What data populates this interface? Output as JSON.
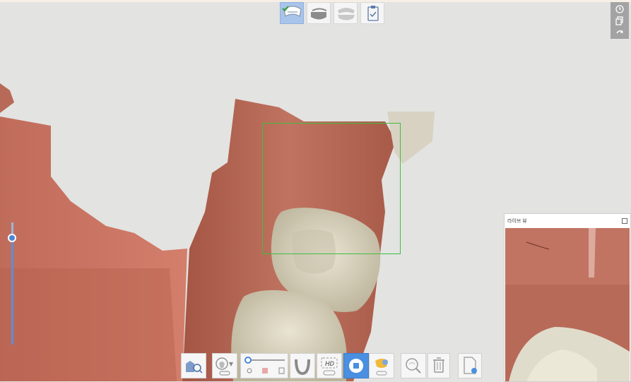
{
  "top_tabs": [
    {
      "label": "upper-jaw",
      "icon": "upper-jaw-icon",
      "active": true,
      "done": true
    },
    {
      "label": "lower-jaw",
      "icon": "lower-jaw-icon",
      "active": false,
      "done": false
    },
    {
      "label": "bite",
      "icon": "bite-icon",
      "active": false,
      "done": false
    },
    {
      "label": "review",
      "icon": "checklist-icon",
      "active": false,
      "done": false
    }
  ],
  "right_tools": [
    "history-icon",
    "copy-icon",
    "undo-icon"
  ],
  "live_view": {
    "title": "라이브 뷰"
  },
  "bottom_tools": [
    {
      "name": "scan-mode-button",
      "icon": "scan-person-icon"
    },
    {
      "name": "filter-settings-button",
      "icon": "tooth-filter-icon"
    },
    {
      "name": "brush-size-slider",
      "icon": "slider-icon"
    },
    {
      "name": "arch-view-button",
      "icon": "arch-icon"
    },
    {
      "name": "hd-mode-button",
      "icon": "hd-icon"
    },
    {
      "name": "stop-scan-button",
      "icon": "stop-icon"
    },
    {
      "name": "ai-scan-button",
      "icon": "ai-tooth-icon"
    },
    {
      "name": "zoom-3d-button",
      "icon": "zoom-3d-icon"
    },
    {
      "name": "delete-button",
      "icon": "trash-icon"
    },
    {
      "name": "export-button",
      "icon": "file-export-icon"
    }
  ],
  "colors": {
    "gum": "#b86a58",
    "tooth": "#d9d4c2",
    "scan_box": "#3fbf3f",
    "accent": "#4a8fe0"
  }
}
